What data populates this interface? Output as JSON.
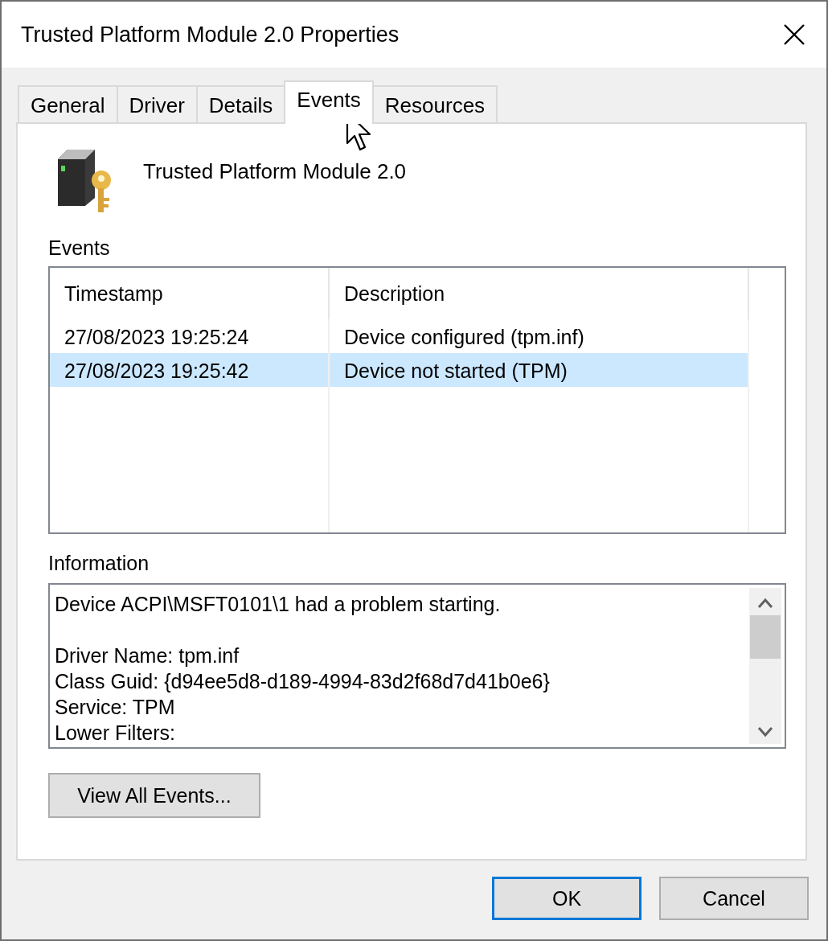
{
  "window": {
    "title": "Trusted Platform Module 2.0 Properties"
  },
  "tabs": [
    {
      "label": "General",
      "selected": false
    },
    {
      "label": "Driver",
      "selected": false
    },
    {
      "label": "Details",
      "selected": false
    },
    {
      "label": "Events",
      "selected": true
    },
    {
      "label": "Resources",
      "selected": false
    }
  ],
  "device": {
    "name": "Trusted Platform Module 2.0"
  },
  "events": {
    "label": "Events",
    "columns": [
      "Timestamp",
      "Description"
    ],
    "rows": [
      {
        "timestamp": "27/08/2023 19:25:24",
        "description": "Device configured (tpm.inf)",
        "selected": false
      },
      {
        "timestamp": "27/08/2023 19:25:42",
        "description": "Device not started (TPM)",
        "selected": true
      }
    ]
  },
  "information": {
    "label": "Information",
    "paragraphs": [
      [
        "Device ACPI\\MSFT0101\\1 had a problem starting."
      ],
      [
        "Driver Name: tpm.inf",
        "Class Guid: {d94ee5d8-d189-4994-83d2f68d7d41b0e6}",
        "Service: TPM",
        "Lower Filters:"
      ]
    ]
  },
  "view_all_button": "View All Events...",
  "dialog_buttons": [
    {
      "label": "OK",
      "default": true
    },
    {
      "label": "Cancel",
      "default": false
    }
  ]
}
